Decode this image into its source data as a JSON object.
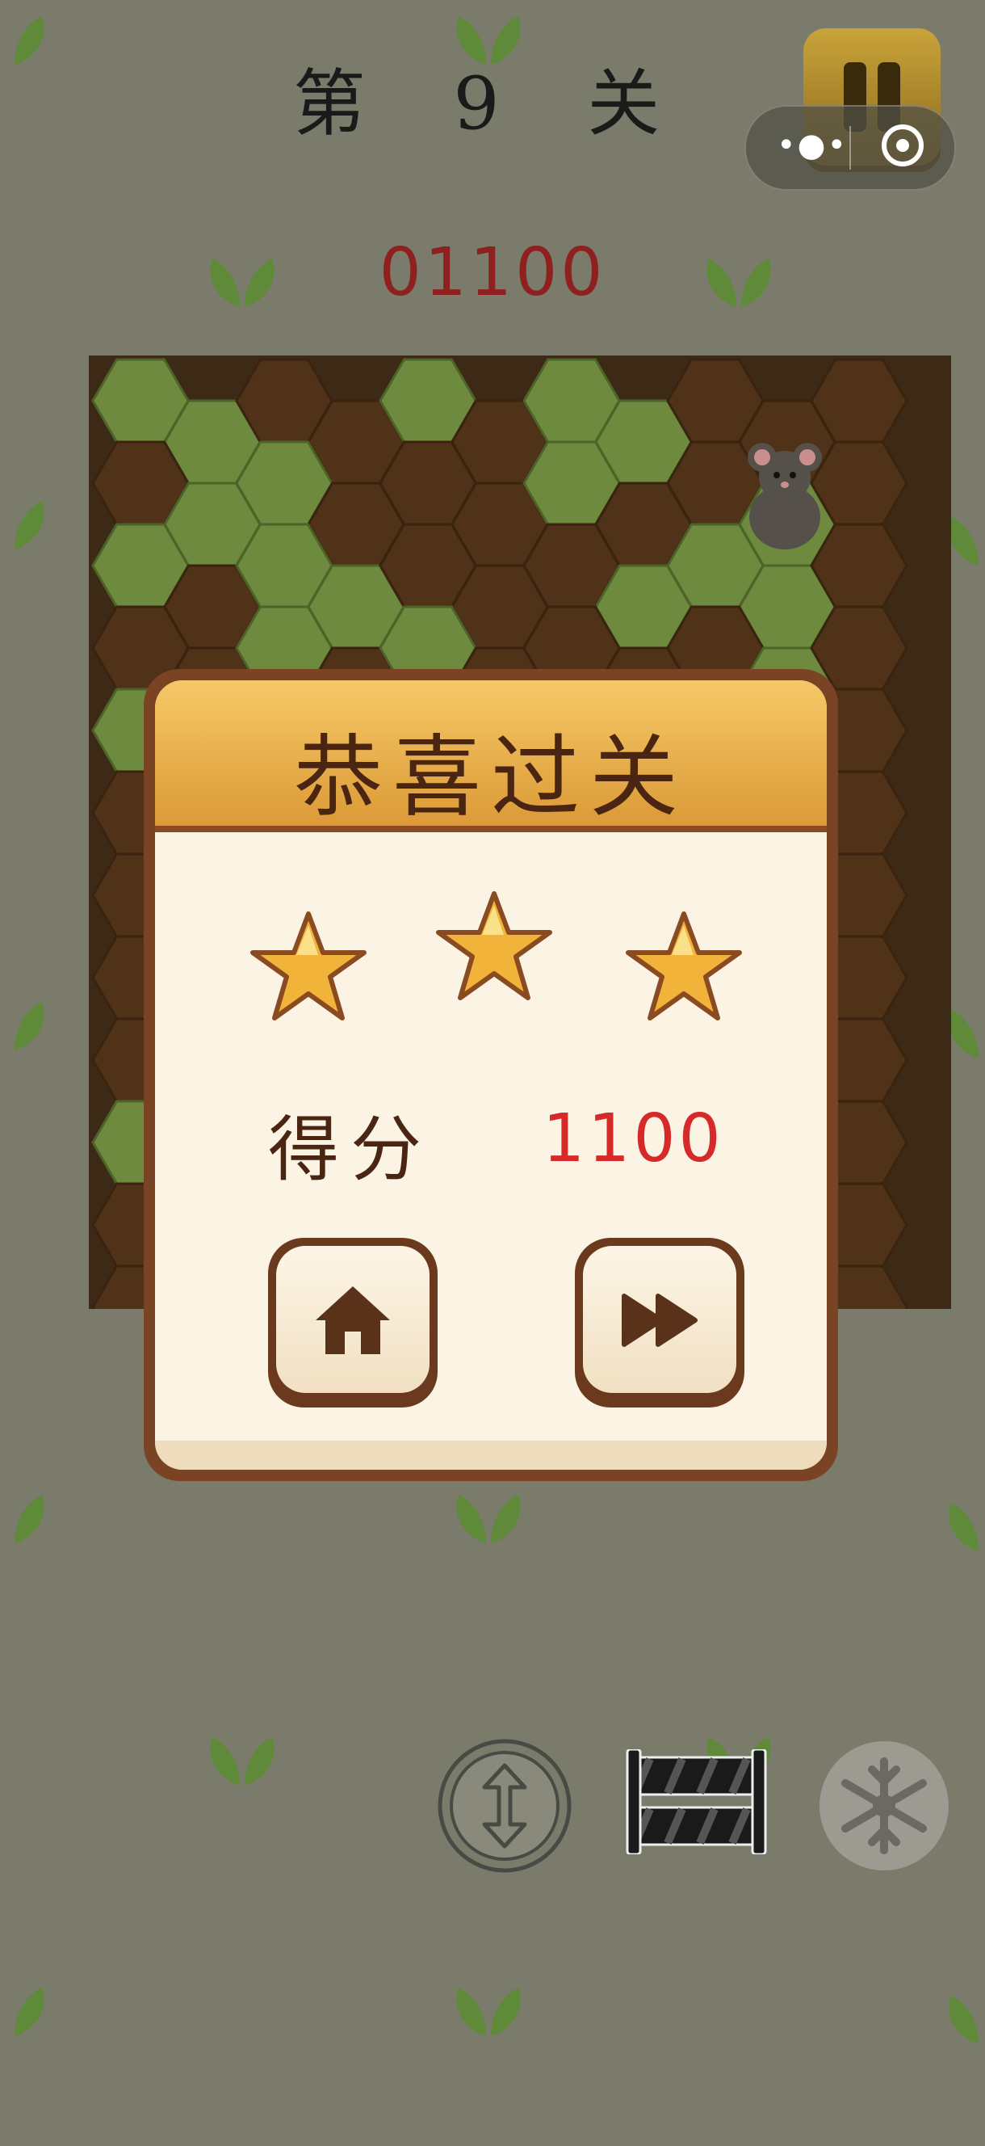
{
  "header": {
    "level_title": "第 9 关",
    "score_display": "01100"
  },
  "system_capsule": {
    "more_icon": "more-dots-icon",
    "close_icon": "target-circle-icon"
  },
  "pause_button": {
    "icon": "pause-icon",
    "color": "#b38a2c"
  },
  "board": {
    "cell_types": {
      "G": "grass",
      "D": "dirt"
    },
    "rows": [
      "GDGGDD",
      "DGDGDD",
      "GGDDGD",
      "DGGDDD",
      "GGGGGD",
      "DDGDDD",
      "DGDGGD",
      "DGDGDD",
      "DDGDDD",
      "GDDGDD",
      "DGDGDD",
      "DDDDDD",
      "GDDDDD",
      "GDGDDD"
    ],
    "mouse": {
      "icon": "mouse-icon"
    },
    "colors": {
      "grass": "#6e8a3f",
      "dirt": "#4f3218"
    }
  },
  "dialog": {
    "title": "恭喜过关",
    "stars": [
      "star-icon",
      "star-icon",
      "star-icon"
    ],
    "stars_earned": 3,
    "score_label": "得分",
    "score_value": "1100",
    "home_button_icon": "home-icon",
    "next_button_icon": "fast-forward-icon"
  },
  "toolbar": {
    "tools": [
      "swap-vertical-icon",
      "barrier-icon",
      "snowflake-icon"
    ]
  },
  "colors": {
    "background": "#7b7b6c",
    "accent": "#d62a2a",
    "dialog_border": "#7a4324",
    "star": "#f2b33a"
  }
}
